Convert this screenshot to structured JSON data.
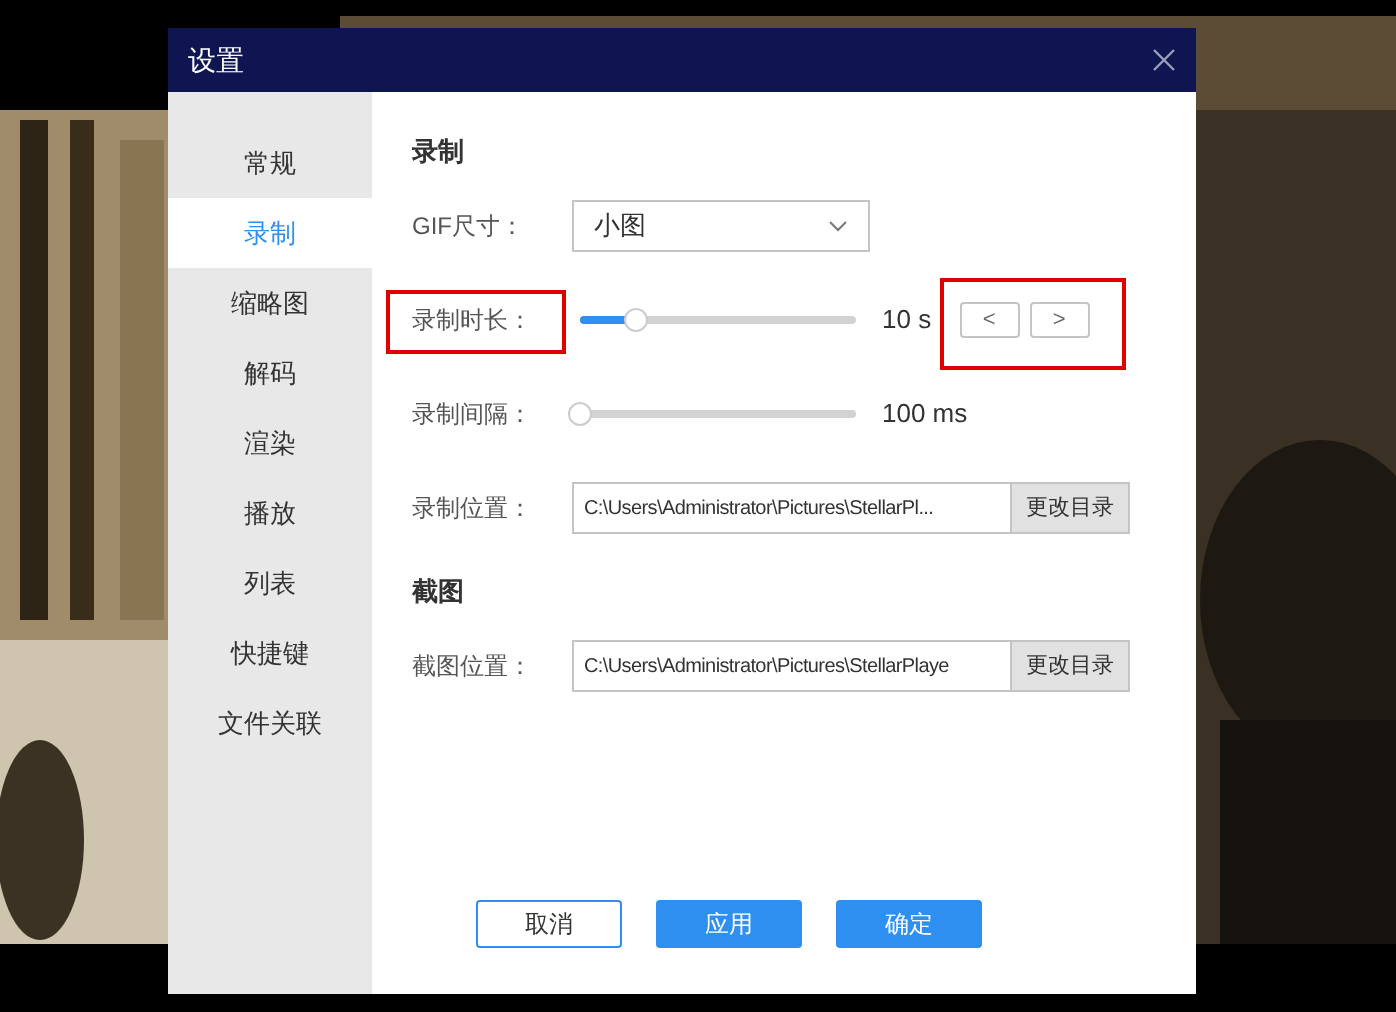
{
  "window": {
    "title": "设置"
  },
  "sidebar": {
    "items": [
      {
        "label": "常规",
        "selected": false
      },
      {
        "label": "录制",
        "selected": true
      },
      {
        "label": "缩略图",
        "selected": false
      },
      {
        "label": "解码",
        "selected": false
      },
      {
        "label": "渲染",
        "selected": false
      },
      {
        "label": "播放",
        "selected": false
      },
      {
        "label": "列表",
        "selected": false
      },
      {
        "label": "快捷键",
        "selected": false
      },
      {
        "label": "文件关联",
        "selected": false
      }
    ]
  },
  "sections": [
    {
      "title": "录制",
      "rows": [
        {
          "kind": "select",
          "label": "GIF尺寸：",
          "value": "小图"
        },
        {
          "kind": "slider",
          "label": "录制时长：",
          "level": 0.2,
          "reading": "10 s",
          "label_highlighted": true,
          "buttons": [
            "<",
            ">"
          ],
          "buttons_highlighted": true
        },
        {
          "kind": "slider",
          "label": "录制间隔：",
          "level": 0,
          "reading": "100 ms",
          "label_highlighted": false
        },
        {
          "kind": "path",
          "label": "录制位置：",
          "value": "C:\\Users\\Administrator\\Pictures\\StellarPl...",
          "button": "更改目录"
        }
      ]
    },
    {
      "title": "截图",
      "rows": [
        {
          "kind": "path",
          "label": "截图位置：",
          "value": "C:\\Users\\Administrator\\Pictures\\StellarPlaye",
          "button": "更改目录"
        }
      ]
    }
  ],
  "footer_buttons": [
    {
      "label": "取消",
      "primary": false
    },
    {
      "label": "应用",
      "primary": true
    },
    {
      "label": "确定",
      "primary": true
    }
  ]
}
